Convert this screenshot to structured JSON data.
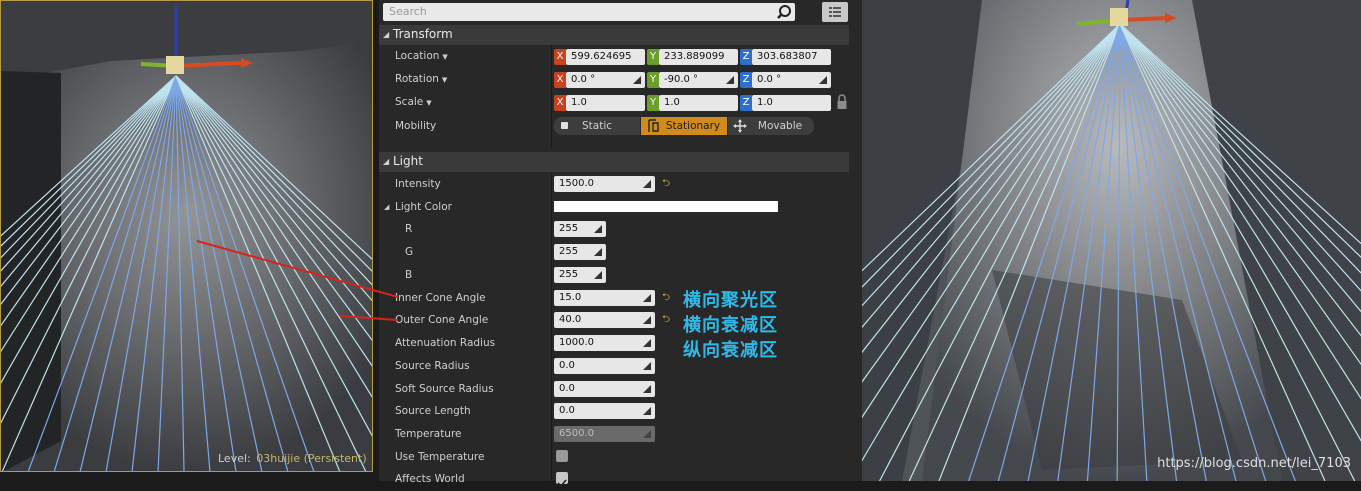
{
  "left_viewport": {
    "level_label": "Level:",
    "level_name": "03huijie (Persistent)"
  },
  "right_viewport": {
    "watermark": "https://blog.csdn.net/lei_7103"
  },
  "search": {
    "placeholder": "Search"
  },
  "transform": {
    "title": "Transform",
    "location": {
      "label": "Location",
      "x": "599.624695",
      "y": "233.889099",
      "z": "303.683807"
    },
    "rotation": {
      "label": "Rotation",
      "x": "0.0 °",
      "y": "-90.0 °",
      "z": "0.0 °"
    },
    "scale": {
      "label": "Scale",
      "x": "1.0",
      "y": "1.0",
      "z": "1.0"
    },
    "mobility": {
      "label": "Mobility",
      "options": [
        "Static",
        "Stationary",
        "Movable"
      ],
      "selected": "Stationary"
    },
    "axis_labels": {
      "x": "X",
      "y": "Y",
      "z": "Z"
    }
  },
  "light": {
    "title": "Light",
    "intensity": {
      "label": "Intensity",
      "value": "1500.0"
    },
    "light_color": {
      "label": "Light Color",
      "r_label": "R",
      "r": "255",
      "g_label": "G",
      "g": "255",
      "b_label": "B",
      "b": "255",
      "swatch_color": "#ffffff"
    },
    "inner_cone_angle": {
      "label": "Inner Cone Angle",
      "value": "15.0"
    },
    "outer_cone_angle": {
      "label": "Outer Cone Angle",
      "value": "40.0"
    },
    "attenuation_radius": {
      "label": "Attenuation Radius",
      "value": "1000.0"
    },
    "source_radius": {
      "label": "Source Radius",
      "value": "0.0"
    },
    "soft_source_radius": {
      "label": "Soft Source Radius",
      "value": "0.0"
    },
    "source_length": {
      "label": "Source Length",
      "value": "0.0"
    },
    "temperature": {
      "label": "Temperature",
      "value": "6500.0"
    },
    "use_temperature": {
      "label": "Use Temperature",
      "checked": false
    },
    "affects_world": {
      "label": "Affects World",
      "checked": true
    }
  },
  "annotations": {
    "inner": "横向聚光区",
    "outer": "横向衰减区",
    "attenuation": "纵向衰减区",
    "color": "#2fb9ea"
  },
  "colors": {
    "accent": "#d18b1c",
    "axis_x": "#c8421f",
    "axis_y": "#6c9e2a",
    "axis_z": "#2c6fcf",
    "annotation_arrow": "#d8231b"
  }
}
